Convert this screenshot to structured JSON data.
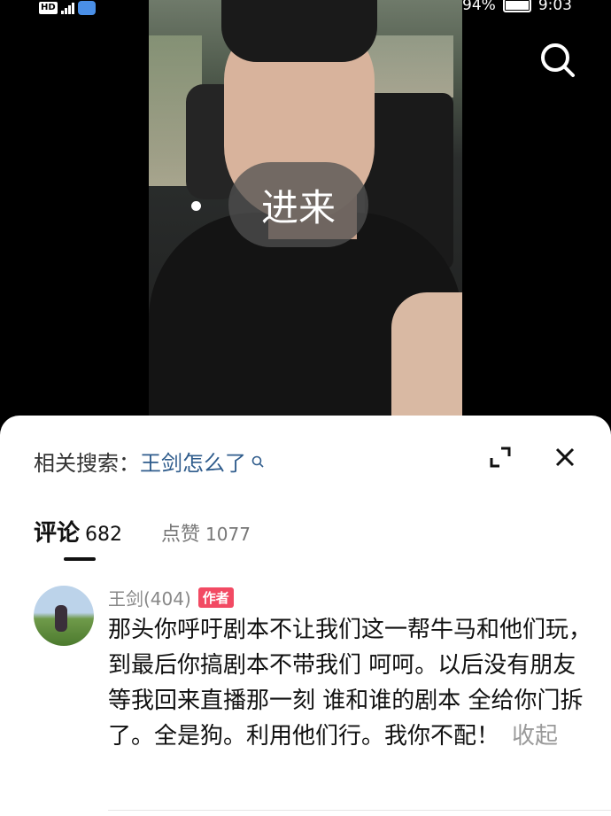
{
  "status_bar": {
    "network_badge": "HD",
    "battery": "94%",
    "time": "9:03"
  },
  "video": {
    "overlay_label": "进来"
  },
  "comments_sheet": {
    "related_label": "相关搜索：",
    "related_keyword": "王剑怎么了",
    "tabs": [
      {
        "label": "评论",
        "count": "682"
      },
      {
        "label": "点赞",
        "count": "1077"
      }
    ],
    "comment": {
      "author": "王剑(404)",
      "badge": "作者",
      "text": "那头你呼吁剧本不让我们这一帮牛马和他们玩， 到最后你搞剧本不带我们 呵呵。以后没有朋友 等我回来直播那一刻 谁和谁的剧本 全给你门拆了。全是狗。利用他们行。我你不配！",
      "collapse_label": "收起"
    }
  }
}
